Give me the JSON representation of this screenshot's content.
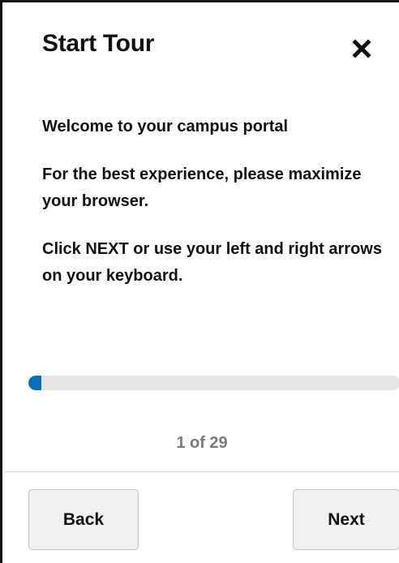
{
  "tour": {
    "title": "Start Tour",
    "close_label": "close-icon",
    "messages": [
      "Welcome to your campus portal",
      "For the best experience, please maximize your browser.",
      "Click NEXT or use your left and right arrows on your keyboard."
    ],
    "progress": {
      "current": 1,
      "total": 29,
      "fraction": 0.034,
      "label": "1 of 29"
    },
    "buttons": {
      "back_label": "Back",
      "next_label": "Next"
    }
  },
  "colors": {
    "progress_fill": "#0a6fb6",
    "progress_track": "#e4e4e4",
    "counter_text": "#7a7a7a",
    "button_background": "#f1f1f1"
  }
}
